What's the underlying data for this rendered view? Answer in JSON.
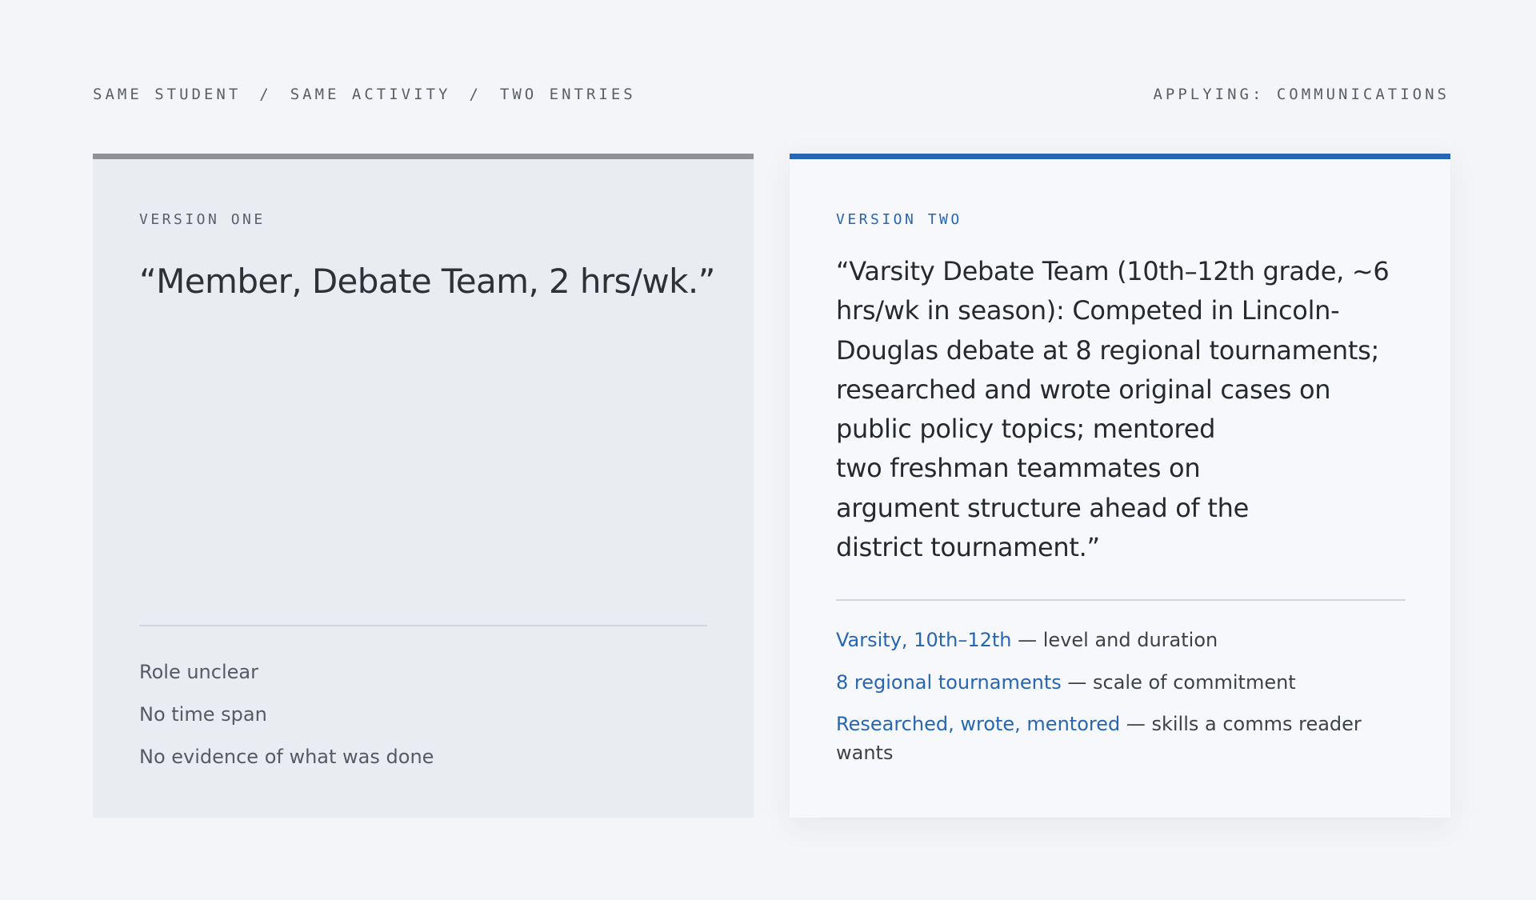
{
  "header": {
    "crumbs": [
      "SAME STUDENT",
      "SAME ACTIVITY",
      "TWO ENTRIES"
    ],
    "separator": "/",
    "applying": "APPLYING: COMMUNICATIONS"
  },
  "version_one": {
    "label": "VERSION ONE",
    "quote": "“Member, Debate Team, 2 hrs/wk.”",
    "notes": [
      "Role unclear",
      "No time span",
      "No evidence of what was done"
    ]
  },
  "version_two": {
    "label": "VERSION TWO",
    "quote_lines": [
      "“Varsity Debate Team (10th–12th grade, ~6",
      "hrs/wk in season): Competed in Lincoln-",
      "Douglas debate at 8 regional tournaments;",
      "researched and wrote original cases on",
      "public policy topics; mentored",
      "two freshman teammates on",
      "argument structure ahead of the",
      "district tournament.”"
    ],
    "notes": [
      {
        "highlight": "Varsity, 10th–12th",
        "text": " — level and duration"
      },
      {
        "highlight": "8 regional tournaments",
        "text": " — scale of commitment"
      },
      {
        "highlight": "Researched, wrote, mentored",
        "text": " — skills a comms reader wants"
      }
    ]
  },
  "colors": {
    "accent": "#2766b3",
    "muted_bar": "#8e9196",
    "background": "#f4f5f8"
  }
}
